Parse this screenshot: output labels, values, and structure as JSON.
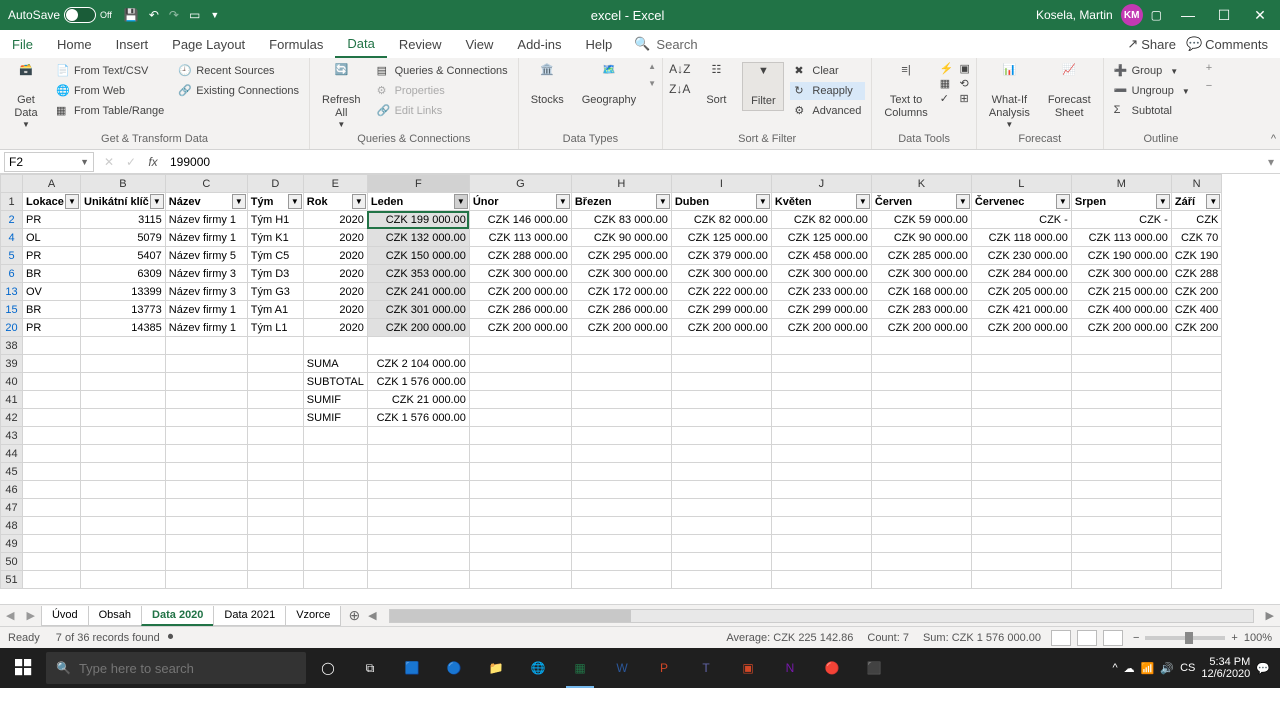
{
  "titlebar": {
    "autosave_label": "AutoSave",
    "autosave_state": "Off",
    "document": "excel  -  Excel",
    "user": "Kosela, Martin",
    "user_initials": "KM"
  },
  "tabs": {
    "items": [
      "File",
      "Home",
      "Insert",
      "Page Layout",
      "Formulas",
      "Data",
      "Review",
      "View",
      "Add-ins",
      "Help"
    ],
    "active": "Data",
    "search_placeholder": "Search",
    "share": "Share",
    "comments": "Comments"
  },
  "ribbon": {
    "groups": {
      "get_transform": {
        "label": "Get & Transform Data",
        "get_data": "Get\nData",
        "from_text_csv": "From Text/CSV",
        "from_web": "From Web",
        "from_table_range": "From Table/Range",
        "recent_sources": "Recent Sources",
        "existing_connections": "Existing Connections"
      },
      "queries": {
        "label": "Queries & Connections",
        "refresh_all": "Refresh\nAll",
        "queries_conn": "Queries & Connections",
        "properties": "Properties",
        "edit_links": "Edit Links"
      },
      "data_types": {
        "label": "Data Types",
        "stocks": "Stocks",
        "geography": "Geography"
      },
      "sort_filter": {
        "label": "Sort & Filter",
        "sort": "Sort",
        "filter": "Filter",
        "clear": "Clear",
        "reapply": "Reapply",
        "advanced": "Advanced"
      },
      "data_tools": {
        "label": "Data Tools",
        "text_to_columns": "Text to\nColumns"
      },
      "forecast": {
        "label": "Forecast",
        "whatif": "What-If\nAnalysis",
        "forecast_sheet": "Forecast\nSheet"
      },
      "outline": {
        "label": "Outline",
        "group": "Group",
        "ungroup": "Ungroup",
        "subtotal": "Subtotal"
      }
    }
  },
  "formula_bar": {
    "namebox": "F2",
    "formula": "199000"
  },
  "columns": [
    {
      "letter": "A",
      "width": 58
    },
    {
      "letter": "B",
      "width": 74
    },
    {
      "letter": "C",
      "width": 82
    },
    {
      "letter": "D",
      "width": 56
    },
    {
      "letter": "E",
      "width": 64
    },
    {
      "letter": "F",
      "width": 102
    },
    {
      "letter": "G",
      "width": 102
    },
    {
      "letter": "H",
      "width": 100
    },
    {
      "letter": "I",
      "width": 100
    },
    {
      "letter": "J",
      "width": 100
    },
    {
      "letter": "K",
      "width": 100
    },
    {
      "letter": "L",
      "width": 100
    },
    {
      "letter": "M",
      "width": 100
    },
    {
      "letter": "N",
      "width": 50
    }
  ],
  "headers": [
    "Lokace",
    "Unikátní klíč",
    "Název",
    "Tým",
    "Rok",
    "Leden",
    "Únor",
    "Březen",
    "Duben",
    "Květen",
    "Červen",
    "Červenec",
    "Srpen",
    "Září"
  ],
  "rows": [
    {
      "n": 2,
      "cells": [
        "PR",
        "3115",
        "Název firmy 1",
        "Tým H1",
        "2020",
        "CZK   199 000.00",
        "CZK   146 000.00",
        "CZK     83 000.00",
        "CZK     82 000.00",
        "CZK     82 000.00",
        "CZK     59 000.00",
        "CZK                 -",
        "CZK                 -",
        "CZK"
      ]
    },
    {
      "n": 4,
      "cells": [
        "OL",
        "5079",
        "Název firmy 1",
        "Tým K1",
        "2020",
        "CZK   132 000.00",
        "CZK   113 000.00",
        "CZK     90 000.00",
        "CZK   125 000.00",
        "CZK   125 000.00",
        "CZK     90 000.00",
        "CZK   118 000.00",
        "CZK   113 000.00",
        "CZK     70"
      ]
    },
    {
      "n": 5,
      "cells": [
        "PR",
        "5407",
        "Název firmy 5",
        "Tým C5",
        "2020",
        "CZK   150 000.00",
        "CZK   288 000.00",
        "CZK   295 000.00",
        "CZK   379 000.00",
        "CZK   458 000.00",
        "CZK   285 000.00",
        "CZK   230 000.00",
        "CZK   190 000.00",
        "CZK   190"
      ]
    },
    {
      "n": 6,
      "cells": [
        "BR",
        "6309",
        "Název firmy 3",
        "Tým D3",
        "2020",
        "CZK   353 000.00",
        "CZK   300 000.00",
        "CZK   300 000.00",
        "CZK   300 000.00",
        "CZK   300 000.00",
        "CZK   300 000.00",
        "CZK   284 000.00",
        "CZK   300 000.00",
        "CZK   288"
      ]
    },
    {
      "n": 13,
      "cells": [
        "OV",
        "13399",
        "Název firmy 3",
        "Tým G3",
        "2020",
        "CZK   241 000.00",
        "CZK   200 000.00",
        "CZK   172 000.00",
        "CZK   222 000.00",
        "CZK   233 000.00",
        "CZK   168 000.00",
        "CZK   205 000.00",
        "CZK   215 000.00",
        "CZK   200"
      ]
    },
    {
      "n": 15,
      "cells": [
        "BR",
        "13773",
        "Název firmy 1",
        "Tým A1",
        "2020",
        "CZK   301 000.00",
        "CZK   286 000.00",
        "CZK   286 000.00",
        "CZK   299 000.00",
        "CZK   299 000.00",
        "CZK   283 000.00",
        "CZK   421 000.00",
        "CZK   400 000.00",
        "CZK   400"
      ]
    },
    {
      "n": 20,
      "cells": [
        "PR",
        "14385",
        "Název firmy 1",
        "Tým L1",
        "2020",
        "CZK   200 000.00",
        "CZK   200 000.00",
        "CZK   200 000.00",
        "CZK   200 000.00",
        "CZK   200 000.00",
        "CZK   200 000.00",
        "CZK   200 000.00",
        "CZK   200 000.00",
        "CZK   200"
      ]
    }
  ],
  "summary_rows": [
    {
      "n": 38,
      "label": "",
      "val": ""
    },
    {
      "n": 39,
      "label": "SUMA",
      "val": "CZK  2 104 000.00"
    },
    {
      "n": 40,
      "label": "SUBTOTAL",
      "val": "CZK  1 576 000.00"
    },
    {
      "n": 41,
      "label": "SUMIF",
      "val": "CZK       21 000.00"
    },
    {
      "n": 42,
      "label": "SUMIF",
      "val": "CZK  1 576 000.00"
    }
  ],
  "empty_rows": [
    43,
    44,
    45,
    46,
    47,
    48,
    49,
    50,
    51
  ],
  "sheet_tabs": {
    "items": [
      "Úvod",
      "Obsah",
      "Data 2020",
      "Data 2021",
      "Vzorce"
    ],
    "active": "Data 2020"
  },
  "statusbar": {
    "ready": "Ready",
    "records": "7 of 36 records found",
    "average": "Average:   CZK 225 142.86",
    "count": "Count: 7",
    "sum": "Sum:   CZK 1 576 000.00",
    "zoom": "100%"
  },
  "taskbar": {
    "search_placeholder": "Type here to search",
    "time": "5:34 PM",
    "date": "12/6/2020"
  }
}
